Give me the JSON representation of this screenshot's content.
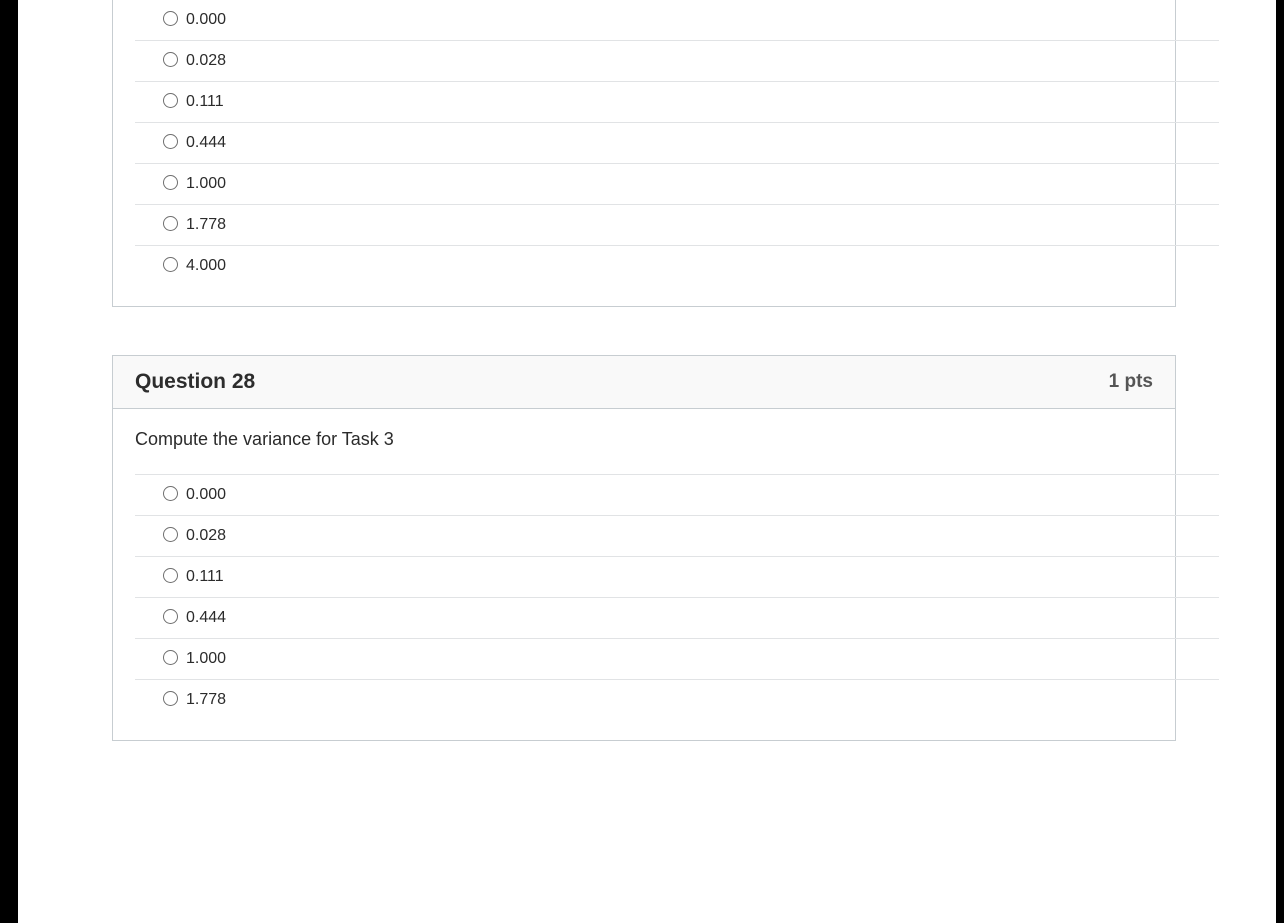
{
  "questions": [
    {
      "id": "q27-partial",
      "title": "",
      "pts": "",
      "prompt": "",
      "partial_top": true,
      "options": [
        {
          "label": "0.000"
        },
        {
          "label": "0.028"
        },
        {
          "label": "0.111"
        },
        {
          "label": "0.444"
        },
        {
          "label": "1.000"
        },
        {
          "label": "1.778"
        },
        {
          "label": "4.000"
        }
      ]
    },
    {
      "id": "q28",
      "title": "Question 28",
      "pts": "1 pts",
      "prompt": "Compute the variance for Task 3",
      "partial_top": false,
      "options": [
        {
          "label": "0.000"
        },
        {
          "label": "0.028"
        },
        {
          "label": "0.111"
        },
        {
          "label": "0.444"
        },
        {
          "label": "1.000"
        },
        {
          "label": "1.778"
        }
      ]
    }
  ]
}
